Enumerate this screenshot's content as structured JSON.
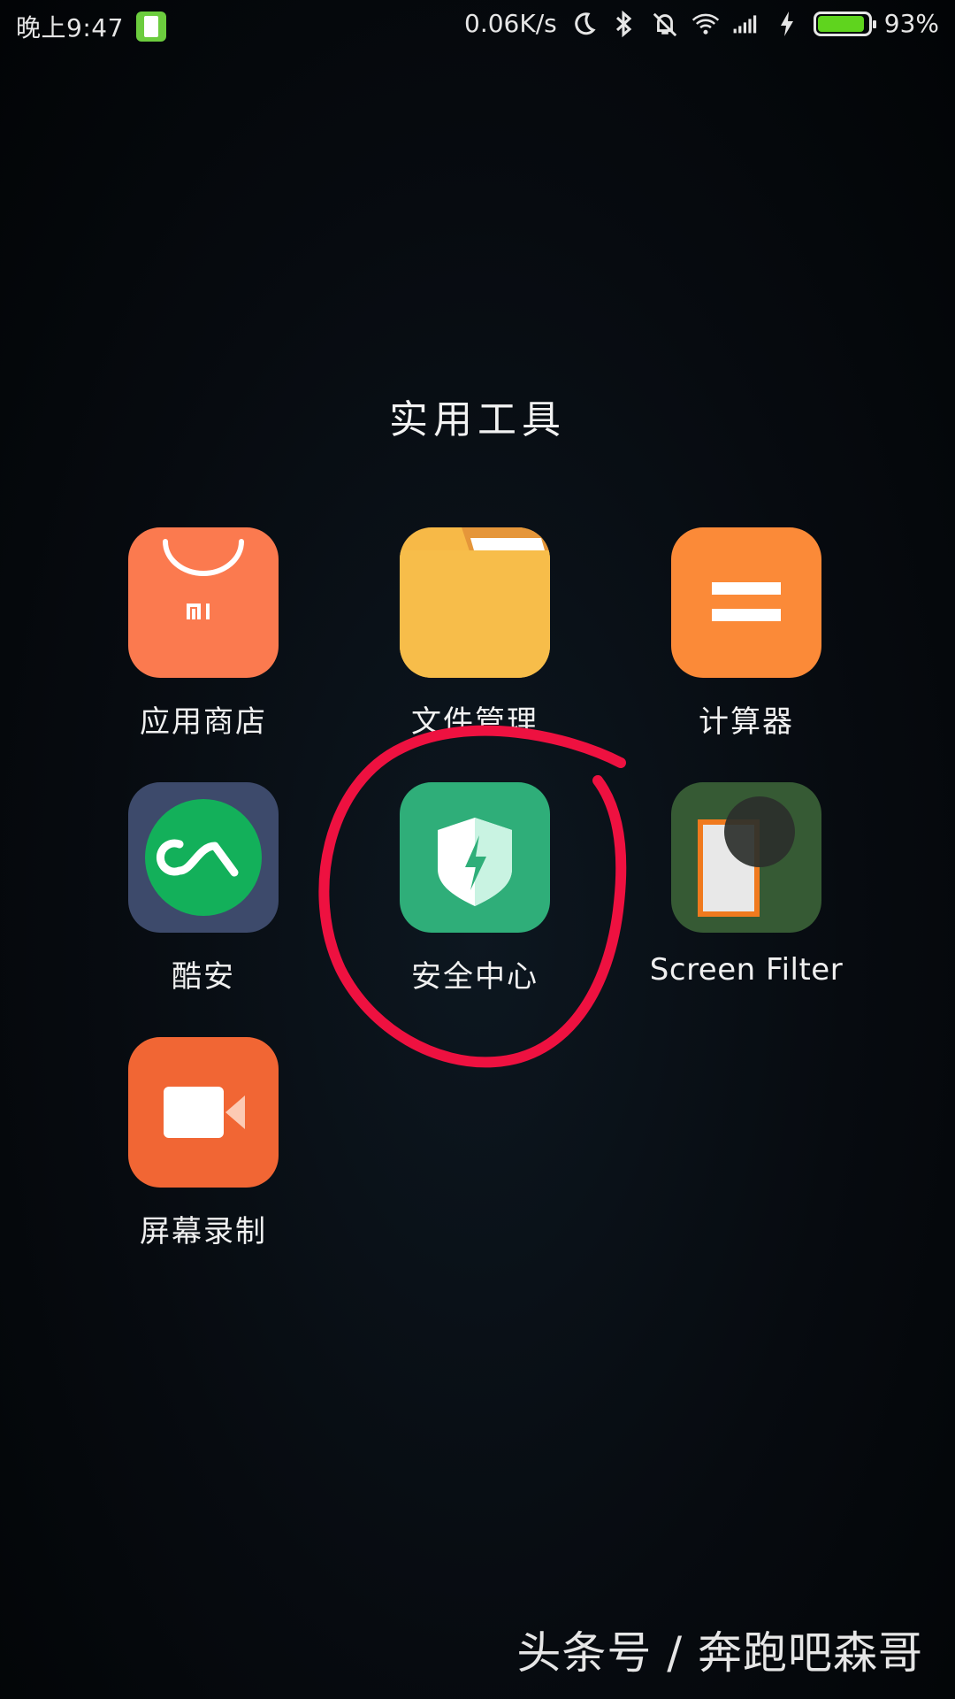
{
  "status_bar": {
    "time": "晚上9:47",
    "network_speed": "0.06K/s",
    "battery_percent": "93%",
    "battery_level": 0.93,
    "icons": [
      "battery-saver-icon",
      "moon-icon",
      "bluetooth-icon",
      "vibrate-off-icon",
      "wifi-icon",
      "signal-icon",
      "charging-icon",
      "battery-icon"
    ]
  },
  "folder": {
    "title": "实用工具",
    "apps": [
      {
        "label": "应用商店",
        "icon": "mi-store-icon",
        "color": "#fb7a4f"
      },
      {
        "label": "文件管理",
        "icon": "folder-icon",
        "color": "#f7b947"
      },
      {
        "label": "计算器",
        "icon": "calculator-icon",
        "color": "#fb8a38"
      },
      {
        "label": "酷安",
        "icon": "coolapk-icon",
        "color": "#3d4a6b"
      },
      {
        "label": "安全中心",
        "icon": "shield-icon",
        "color": "#2fae79"
      },
      {
        "label": "Screen Filter",
        "icon": "screen-filter-icon",
        "color": "#365a34"
      },
      {
        "label": "屏幕录制",
        "icon": "video-camera-icon",
        "color": "#f16634"
      }
    ]
  },
  "annotation": {
    "color": "#ee1140",
    "target": "安全中心"
  },
  "watermark": "头条号 / 奔跑吧森哥"
}
